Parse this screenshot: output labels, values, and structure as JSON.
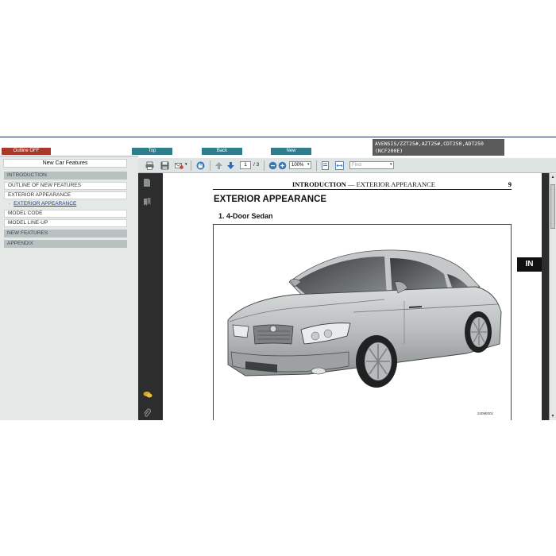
{
  "vehicle_box": {
    "line1": "AVENSIS/ZZT25#,AZT25#,CDT250,ADT250",
    "line2": "(NCF200E)"
  },
  "nav_buttons": {
    "outline": "Outline OFF",
    "top": "Top",
    "back": "Back",
    "new": "New"
  },
  "sidebar": {
    "header": "New Car Features",
    "items": [
      {
        "label": "INTRODUCTION",
        "kind": "section"
      },
      {
        "label": "OUTLINE OF NEW FEATURES",
        "kind": "plain"
      },
      {
        "label": "EXTERIOR APPEARANCE",
        "kind": "plain"
      },
      {
        "label": "EXTERIOR APPEARANCE",
        "kind": "link",
        "bullet": "·"
      },
      {
        "label": "MODEL CODE",
        "kind": "plain"
      },
      {
        "label": "MODEL LINE-UP",
        "kind": "plain"
      },
      {
        "label": "NEW FEATURES",
        "kind": "section"
      },
      {
        "label": "APPENDIX",
        "kind": "section"
      }
    ]
  },
  "toolbar": {
    "page_current": "1",
    "page_total": "/ 3",
    "zoom": "100%",
    "find_placeholder": "Find",
    "icons": [
      "print-icon",
      "save-icon",
      "email-icon",
      "hand-tool-icon",
      "previous-page-icon",
      "next-page-icon",
      "zoom-out-icon",
      "zoom-in-icon",
      "fit-page-icon",
      "fit-width-icon"
    ]
  },
  "document": {
    "header_section": "INTRODUCTION",
    "header_dash": " — ",
    "header_topic": "EXTERIOR APPEARANCE",
    "page_number": "9",
    "heading": "EXTERIOR APPEARANCE",
    "subheading": "1.  4-Door Sedan",
    "figure_code": "240MI001",
    "side_tab": "IN"
  },
  "colors": {
    "outline_button": "#a8392b",
    "nav_button": "#2f7d8a",
    "panel_bg": "#e4e8e7",
    "rail_bg": "#2d2d2d",
    "accent_line": "#1c2a5a"
  }
}
